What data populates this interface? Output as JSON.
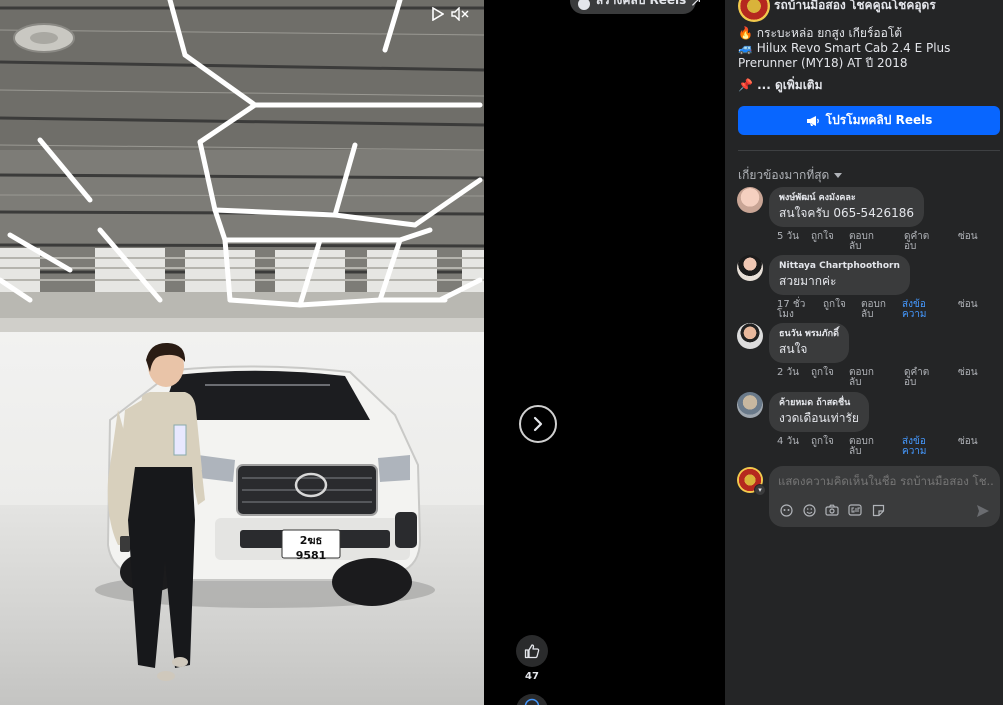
{
  "video": {
    "play_icon": "play-icon",
    "mute_icon": "volume-muted-icon",
    "plate_number": "2ฆธ 9581"
  },
  "strip": {
    "create_reels_label": "สร้างคลิป Reels",
    "like_count": "47"
  },
  "post": {
    "page_name": "รถบ้านมือสอง โชคคูณโชคอุดร",
    "caption": [
      "🔥 กระบะหล่อ ยกสูง เกียร์ออโต้",
      "🚙 Hilux Revo Smart Cab 2.4 E Plus Prerunner (MY18) AT ปี 2018"
    ],
    "see_more": "📌 ... ดูเพิ่มเติม",
    "promote_label": "โปรโมทคลิป Reels",
    "sort_label": "เกี่ยวข้องมากที่สุด"
  },
  "comments": [
    {
      "author": "พงษ์พัฒน์ คงมังคละ",
      "text": "สนใจครับ 065-5426186",
      "time": "5 วัน",
      "like": "ถูกใจ",
      "reply": "ตอบกลับ",
      "extra": "ดูคำตอบ",
      "hide": "ซ่อน"
    },
    {
      "author": "Nittaya Chartphoothorn",
      "text": "สวยมากค่ะ",
      "time": "17 ชั่วโมง",
      "like": "ถูกใจ",
      "reply": "ตอบกลับ",
      "extra": "ส่งข้อความ",
      "hide": "ซ่อน"
    },
    {
      "author": "ธนวัน พรมภักดิ์",
      "text": "สนใจ",
      "time": "2 วัน",
      "like": "ถูกใจ",
      "reply": "ตอบกลับ",
      "extra": "ดูคำตอบ",
      "hide": "ซ่อน"
    },
    {
      "author": "ค้ายหมด ถ้าสดชื่น",
      "text": "งวดเดือนเท่ารัย",
      "time": "4 วัน",
      "like": "ถูกใจ",
      "reply": "ตอบกลับ",
      "extra": "ส่งข้อความ",
      "hide": "ซ่อน"
    }
  ],
  "composer": {
    "placeholder": "แสดงความคิดเห็นในชื่อ รถบ้านมือสอง โช..."
  },
  "colors": {
    "panel_bg": "#242526",
    "bubble_bg": "#3a3b3c",
    "accent": "#0866ff",
    "link_blue": "#4599ff"
  }
}
